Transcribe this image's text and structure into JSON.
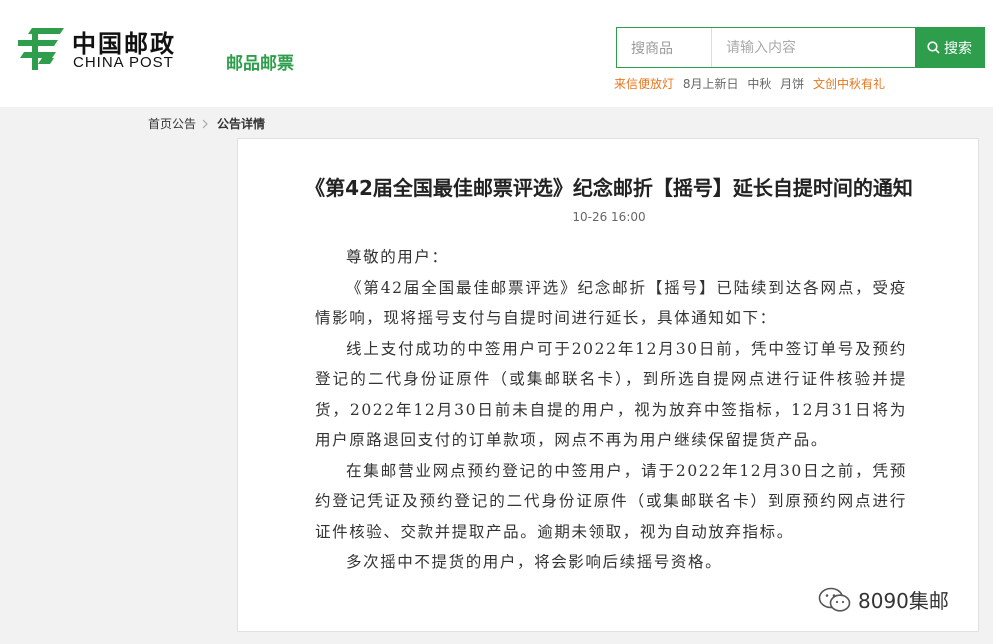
{
  "header": {
    "logo_cn": "中国邮政",
    "logo_en": "CHINA POST",
    "channel": "邮品邮票",
    "search": {
      "scope": "搜商品",
      "placeholder": "请输入内容",
      "button": "搜索"
    },
    "hotwords": [
      "来信便放灯",
      "8月上新日",
      "中秋",
      "月饼",
      "文创中秋有礼"
    ]
  },
  "breadcrumb": {
    "home": "首页公告",
    "current": "公告详情"
  },
  "article": {
    "title": "《第42届全国最佳邮票评选》纪念邮折【摇号】延长自提时间的通知",
    "date": "10-26 16:00",
    "paragraphs": [
      "尊敬的用户：",
      "《第42届全国最佳邮票评选》纪念邮折【摇号】已陆续到达各网点，受疫情影响，现将摇号支付与自提时间进行延长，具体通知如下：",
      "线上支付成功的中签用户可于2022年12月30日前，凭中签订单号及预约登记的二代身份证原件（或集邮联名卡），到所选自提网点进行证件核验并提货，2022年12月30日前未自提的用户，视为放弃中签指标，12月31日将为用户原路退回支付的订单款项，网点不再为用户继续保留提货产品。",
      "在集邮营业网点预约登记的中签用户，请于2022年12月30日之前，凭预约登记凭证及预约登记的二代身份证原件（或集邮联名卡）到原预约网点进行证件核验、交款并提取产品。逾期未领取，视为自动放弃指标。",
      "多次摇中不提货的用户，将会影响后续摇号资格。"
    ]
  },
  "watermark": "8090集邮",
  "colors": {
    "brand_green": "#2e9e4c",
    "hot_orange": "#e8761c"
  },
  "icons": [
    "china-post-logo-icon",
    "search-icon",
    "chevron-right-icon",
    "wechat-icon"
  ]
}
